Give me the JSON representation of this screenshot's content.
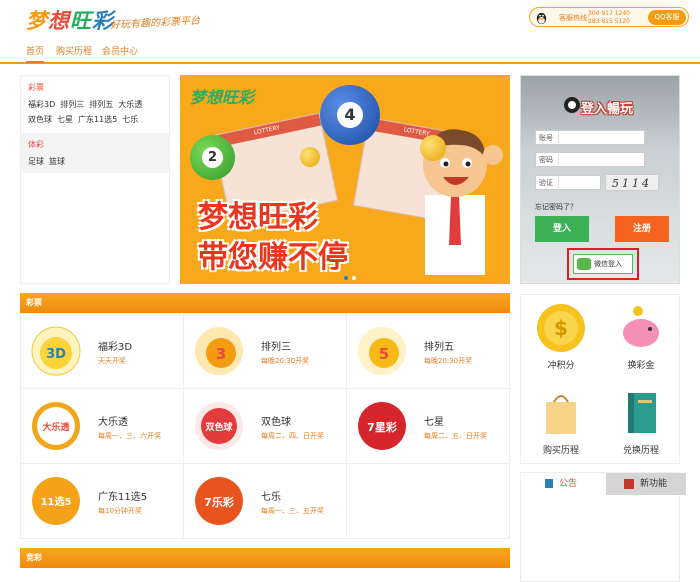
{
  "header": {
    "logo_text": "梦想旺彩",
    "slogan": "好玩有趣的彩票平台",
    "hotline_label": "客服热线：",
    "hotline_numbers": [
      "304 917 1240",
      "283 815 5120"
    ],
    "qq_button": "QQ客服"
  },
  "nav": {
    "items": [
      {
        "label": "首页"
      },
      {
        "label": "购买历程"
      },
      {
        "label": "会员中心"
      }
    ]
  },
  "categories": {
    "lottery_title": "彩票",
    "lottery_items": [
      "福彩3D",
      "排列三",
      "排列五",
      "大乐透",
      "双色球",
      "七星",
      "广东11选5",
      "七乐"
    ],
    "sports_title": "体彩",
    "sports_items": [
      "足球",
      "篮球"
    ]
  },
  "banner": {
    "logo": "梦想旺彩",
    "line1": "梦想旺彩",
    "line2": "带您赚不停",
    "ticket_label": "LOTTERY",
    "balls": [
      "4",
      "2"
    ]
  },
  "login": {
    "title": "登入暢玩",
    "account_label": "账号",
    "password_label": "密码",
    "captcha_label": "验证",
    "captcha_text": "5114",
    "forgot": "忘记密码了？",
    "login_button": "登入",
    "register_button": "注册",
    "wechat_button": "微信登入"
  },
  "lottery_section": {
    "title": "彩票",
    "items": [
      {
        "name": "福彩3D",
        "desc": "天天开奖",
        "icon_text": "3D",
        "color": "#fbd33a"
      },
      {
        "name": "排列三",
        "desc": "每晚20:30开奖",
        "icon_text": "3",
        "color": "#f39c12"
      },
      {
        "name": "排列五",
        "desc": "每晚20:30开奖",
        "icon_text": "5",
        "color": "#f7b916"
      },
      {
        "name": "大乐透",
        "desc": "每周一、三、六开奖",
        "icon_text": "大乐透",
        "color": "#f1a61a"
      },
      {
        "name": "双色球",
        "desc": "每周二、四、日开奖",
        "icon_text": "双色球",
        "color": "#e23b3b"
      },
      {
        "name": "七星",
        "desc": "每周二、五、日开奖",
        "icon_text": "7星彩",
        "color": "#d7262b"
      },
      {
        "name": "广东11选5",
        "desc": "每10分钟开奖",
        "icon_text": "11选5",
        "color": "#f6a219"
      },
      {
        "name": "七乐",
        "desc": "每周一、三、五开奖",
        "icon_text": "7乐彩",
        "color": "#f39c12"
      }
    ]
  },
  "quick_actions": [
    {
      "label": "冲积分",
      "icon": "coin-icon"
    },
    {
      "label": "换彩金",
      "icon": "piggy-bank-icon"
    },
    {
      "label": "购买历程",
      "icon": "shopping-bag-icon"
    },
    {
      "label": "兑换历程",
      "icon": "notebook-icon"
    }
  ],
  "notice_tabs": {
    "announcement": "公告",
    "new_features": "新功能"
  },
  "jingcai_section": {
    "title": "竞彩"
  },
  "colors": {
    "accent": "#f39c12",
    "brand_red": "#e74c3c",
    "login_green": "#3cb054",
    "register_orange": "#f5641e"
  }
}
